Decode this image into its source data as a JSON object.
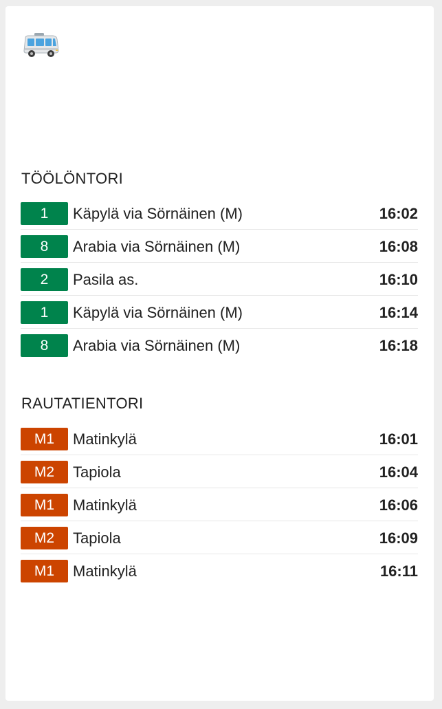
{
  "header": {
    "icon": "bus-icon"
  },
  "colors": {
    "tram": "#00834c",
    "metro": "#cc4400",
    "card": "#ffffff",
    "background": "#eeeeee"
  },
  "stops": [
    {
      "name": "TÖÖLÖNTORI",
      "departures": [
        {
          "line": "1",
          "mode": "tram",
          "destination": "Käpylä via Sörnäinen (M)",
          "time": "16:02"
        },
        {
          "line": "8",
          "mode": "tram",
          "destination": "Arabia via Sörnäinen (M)",
          "time": "16:08"
        },
        {
          "line": "2",
          "mode": "tram",
          "destination": "Pasila as.",
          "time": "16:10"
        },
        {
          "line": "1",
          "mode": "tram",
          "destination": "Käpylä via Sörnäinen (M)",
          "time": "16:14"
        },
        {
          "line": "8",
          "mode": "tram",
          "destination": "Arabia via Sörnäinen (M)",
          "time": "16:18"
        }
      ]
    },
    {
      "name": "RAUTATIENTORI",
      "departures": [
        {
          "line": "M1",
          "mode": "metro",
          "destination": "Matinkylä",
          "time": "16:01"
        },
        {
          "line": "M2",
          "mode": "metro",
          "destination": "Tapiola",
          "time": "16:04"
        },
        {
          "line": "M1",
          "mode": "metro",
          "destination": "Matinkylä",
          "time": "16:06"
        },
        {
          "line": "M2",
          "mode": "metro",
          "destination": "Tapiola",
          "time": "16:09"
        },
        {
          "line": "M1",
          "mode": "metro",
          "destination": "Matinkylä",
          "time": "16:11"
        }
      ]
    }
  ]
}
